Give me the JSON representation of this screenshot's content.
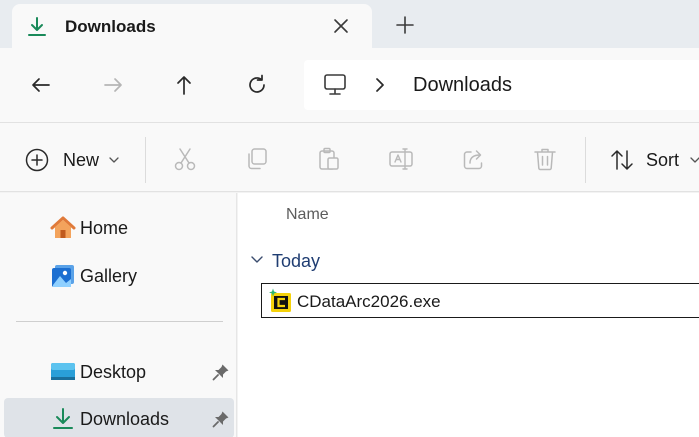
{
  "tab": {
    "title": "Downloads"
  },
  "address": {
    "location": "Downloads"
  },
  "toolbar": {
    "new_label": "New",
    "sort_label": "Sort"
  },
  "sidebar": {
    "items": [
      {
        "label": "Home"
      },
      {
        "label": "Gallery"
      },
      {
        "label": "Desktop"
      },
      {
        "label": "Downloads"
      }
    ]
  },
  "content": {
    "column_name": "Name",
    "group_title": "Today",
    "files": [
      {
        "name": "CDataArc2026.exe"
      }
    ]
  },
  "colors": {
    "accent": "#1a8a5a",
    "selected": "#dfe3e8",
    "group_text": "#1f3d72"
  }
}
